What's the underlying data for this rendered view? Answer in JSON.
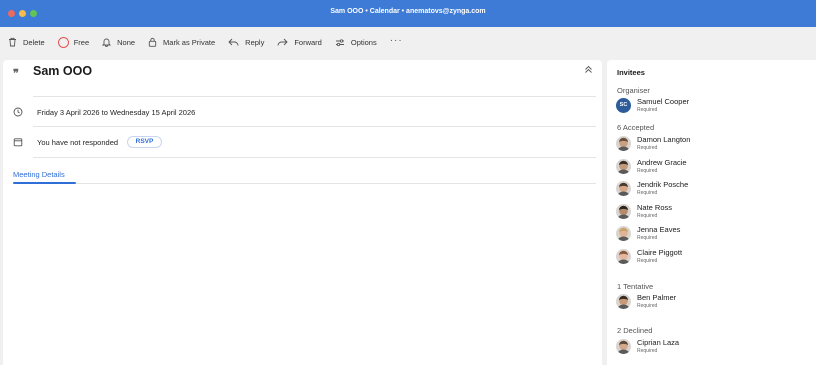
{
  "window": {
    "title": "Sam OOO • Calendar • anematovs@zynga.com"
  },
  "toolbar": {
    "delete": "Delete",
    "free": "Free",
    "none": "None",
    "mark_private": "Mark as Private",
    "reply": "Reply",
    "forward": "Forward",
    "options": "Options",
    "more": "···"
  },
  "event": {
    "subject": "Sam OOO",
    "date_range": "Friday 3 April 2026 to Wednesday 15 April 2026",
    "response_status": "You have not responded",
    "rsvp_label": "RSVP",
    "tab_label": "Meeting Details"
  },
  "invitees": {
    "title": "Invitees",
    "organiser_label": "Organiser",
    "organiser": {
      "name": "Samuel Cooper",
      "initials": "SC",
      "role": "Required"
    },
    "accepted_label": "6 Accepted",
    "accepted": [
      {
        "name": "Damon Langton",
        "role": "Required",
        "skin": "#caa083",
        "hair": "#6b4f3a"
      },
      {
        "name": "Andrew Gracie",
        "role": "Required",
        "skin": "#c49a7c",
        "hair": "#3a2e26"
      },
      {
        "name": "Jendrik Posche",
        "role": "Required",
        "skin": "#d6a787",
        "hair": "#4a3a2e"
      },
      {
        "name": "Nate Ross",
        "role": "Required",
        "skin": "#b58a6e",
        "hair": "#2a2320"
      },
      {
        "name": "Jenna Eaves",
        "role": "Required",
        "skin": "#e0b497",
        "hair": "#c9a26c"
      },
      {
        "name": "Claire Piggott",
        "role": "Required",
        "skin": "#e2b99c",
        "hair": "#8a5a3a"
      }
    ],
    "tentative_label": "1 Tentative",
    "tentative": [
      {
        "name": "Ben Palmer",
        "role": "Required",
        "skin": "#c99a7a",
        "hair": "#3a2b22"
      }
    ],
    "declined_label": "2 Declined",
    "declined": [
      {
        "name": "Ciprian Laza",
        "role": "Required",
        "skin": "#d2a98c",
        "hair": "#5b4a3c"
      }
    ]
  },
  "colors": {
    "titlebar": "#3d7bd6",
    "accent": "#2f6ed6",
    "free_ring": "#e55353",
    "organiser_avatar": "#2c5c9a"
  }
}
